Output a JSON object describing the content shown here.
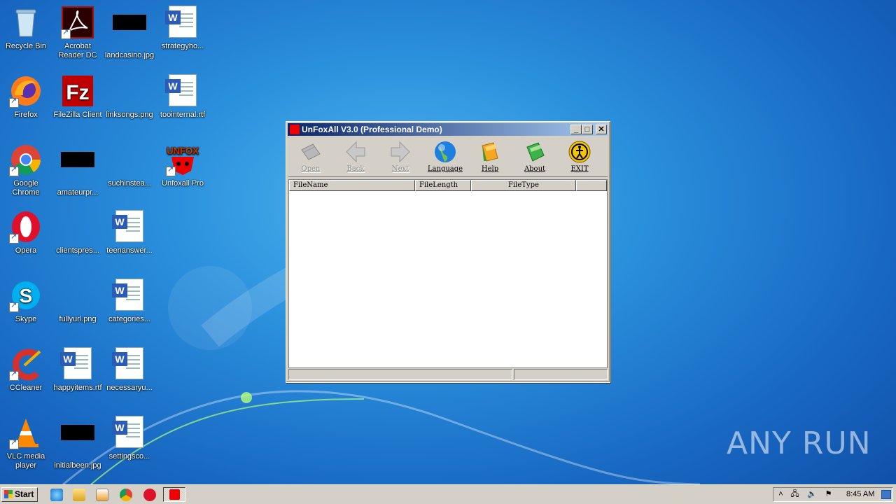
{
  "desktop": {
    "icons": [
      {
        "label": "Recycle Bin"
      },
      {
        "label": "Acrobat Reader DC"
      },
      {
        "label": "landcasino.jpg"
      },
      {
        "label": "strategyho..."
      },
      {
        "label": "Firefox"
      },
      {
        "label": "FileZilla Client"
      },
      {
        "label": "linksongs.png"
      },
      {
        "label": "toointernal.rtf"
      },
      {
        "label": "Google Chrome"
      },
      {
        "label": "amateurpr..."
      },
      {
        "label": "suchinstea..."
      },
      {
        "label": "Unfoxall Pro"
      },
      {
        "label": "Opera"
      },
      {
        "label": "clientspres..."
      },
      {
        "label": "teenanswer..."
      },
      {
        "label": "Skype"
      },
      {
        "label": "fullyurl.png"
      },
      {
        "label": "categories..."
      },
      {
        "label": "CCleaner"
      },
      {
        "label": "happyitems.rtf"
      },
      {
        "label": "necessaryu..."
      },
      {
        "label": "VLC media player"
      },
      {
        "label": "initialbeen.jpg"
      },
      {
        "label": "settingsco..."
      }
    ]
  },
  "window": {
    "title": "UnFoxAll V3.0 (Professional Demo)",
    "toolbar": [
      {
        "label": "Open",
        "icon": "open-icon",
        "enabled": false
      },
      {
        "label": "Back",
        "icon": "back-arrow-icon",
        "enabled": false
      },
      {
        "label": "Next",
        "icon": "next-arrow-icon",
        "enabled": false
      },
      {
        "label": "Language",
        "icon": "globe-icon",
        "enabled": true
      },
      {
        "label": "Help",
        "icon": "help-book-icon",
        "enabled": true
      },
      {
        "label": "About",
        "icon": "about-book-icon",
        "enabled": true
      },
      {
        "label": "EXIT",
        "icon": "exit-icon",
        "enabled": true
      }
    ],
    "columns": [
      "FileName",
      "FileLength",
      "FileType"
    ],
    "rows": []
  },
  "taskbar": {
    "start_label": "Start",
    "clock": "8:45 AM"
  },
  "watermark": "ANY RUN"
}
